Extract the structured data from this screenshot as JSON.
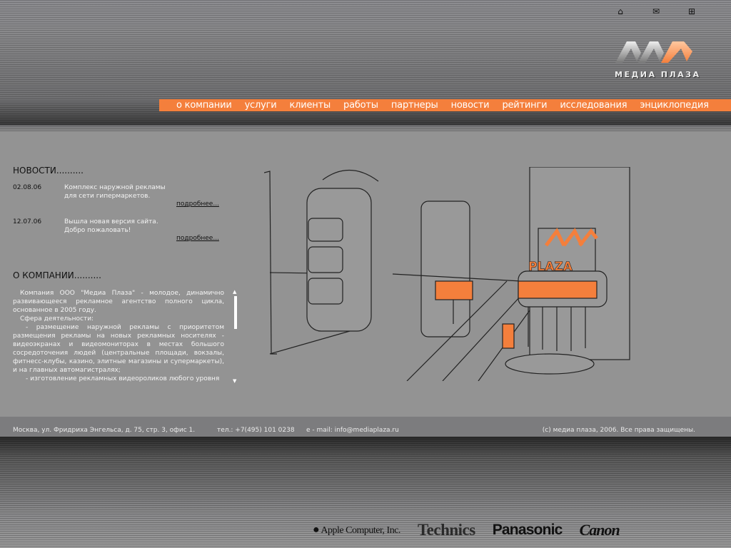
{
  "header": {
    "logo_text": "МЕДИА ПЛАЗА",
    "icons": [
      "home-icon",
      "mail-icon",
      "sitemap-icon"
    ]
  },
  "nav": [
    "о компании",
    "услуги",
    "клиенты",
    "работы",
    "партнеры",
    "новости",
    "рейтинги",
    "исследования",
    "энциклопедия"
  ],
  "news": {
    "title": "НОВОСТИ..........",
    "items": [
      {
        "date": "02.08.06",
        "line1": "Комплекс наружной рекламы",
        "line2": "для сети гипермаркетов.",
        "more": "подробнее..."
      },
      {
        "date": "12.07.06",
        "line1": "Вышла новая версия сайта.",
        "line2": "Добро пожаловать!",
        "more": "подробнее..."
      }
    ]
  },
  "about": {
    "title": "О КОМПАНИИ..........",
    "paragraphs": [
      "Компания ООО \"Медиа Плаза\" - молодое, динамично развивающееся рекламное агентство полного цикла, основанное в 2005 году.",
      "Сфера деятельности:",
      "- размещение наружной рекламы с приоритетом размещения рекламы на новых рекламных носителях - видеоэкранах и видеомониторах в местах большого сосредоточения людей (центральные площади, вокзалы, фитнесс-клубы, казино, элитные магазины и супермаркеты), и на главных автомагистралях;",
      "- изготовление рекламных видеороликов любого уровня"
    ]
  },
  "illustration": {
    "sign": "PLAZA"
  },
  "footer": {
    "address": "Москва, ул. Фридриха Энгельса, д. 75, стр. 3, офис 1.",
    "phone": "тел.: +7(495) 101 0238",
    "email": "e - mail: info@mediaplaza.ru",
    "copyright": "(c) медиа плаза, 2006. Все права защищены."
  },
  "brands": [
    "Apple Computer, Inc.",
    "Technics",
    "Panasonic",
    "Canon"
  ],
  "colors": {
    "accent": "#f47f3c",
    "background": "#939393"
  }
}
